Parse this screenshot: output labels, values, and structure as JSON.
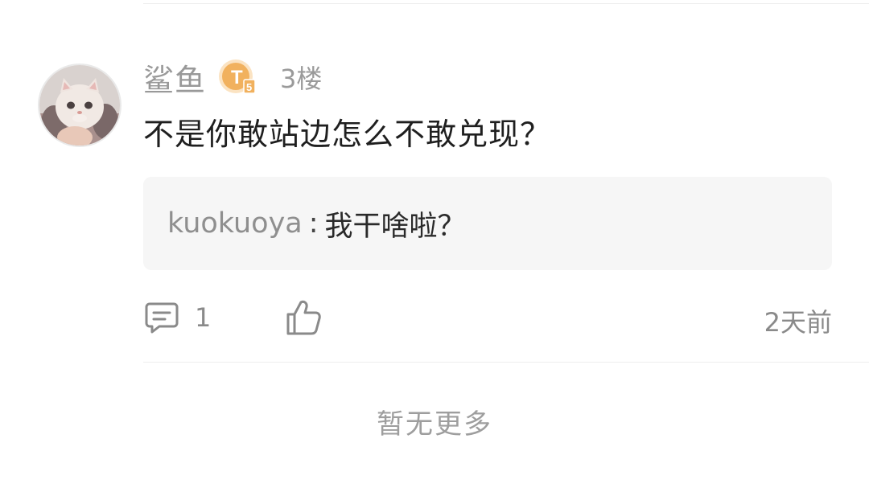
{
  "comment": {
    "username": "鲨鱼",
    "level_badge": "T5",
    "floor": "3楼",
    "text": "不是你敢站边怎么不敢兑现？",
    "reply": {
      "author": "kuokuoya",
      "separator": ":",
      "text": "我干啥啦？"
    },
    "reply_count": "1",
    "time": "2天前",
    "icons": {
      "avatar": "cat-avatar",
      "badge": "level-badge-icon",
      "comment": "comment-icon",
      "like": "thumbs-up-icon"
    },
    "colors": {
      "badge": "#f1b15e",
      "reply_bg": "#f6f6f6"
    }
  },
  "footer": {
    "no_more": "暂无更多"
  }
}
